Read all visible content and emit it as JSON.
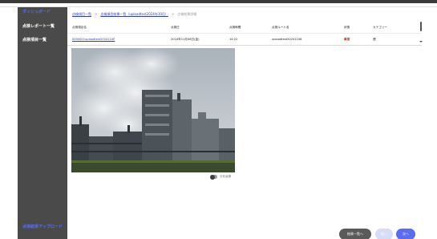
{
  "sidebar": {
    "dashboard": "ダッシュボード",
    "inspection_report_list": "点検レポート一覧",
    "inspection_item_list": "点検項目一覧",
    "result_upload": "点検結果アップロード"
  },
  "breadcrumb": {
    "items": [
      "点検項目一覧",
      "点検項目結果一覧（uploadtest2024年10月）",
      "点検結果詳細"
    ]
  },
  "table": {
    "headers": [
      "点検項目名",
      "点検日",
      "点検時間",
      "点検ルート名",
      "状態",
      "カテゴリー"
    ],
    "row": [
      "0000001uploadtest2024110E",
      "2024年11月08日(金)",
      "14:22",
      "uploadtest20241108",
      "異常",
      "煙"
    ]
  },
  "photo": {
    "subject": "industrial plant with steam plumes"
  },
  "toggle": {
    "label": "分析画像"
  },
  "buttons": {
    "back_to_list": "結果一覧へ",
    "prev": "前へ",
    "next": "次へ"
  },
  "colors": {
    "accent": "#5b6cf2",
    "sidebar_bg": "#4a4a4a",
    "alert": "#e02020"
  }
}
